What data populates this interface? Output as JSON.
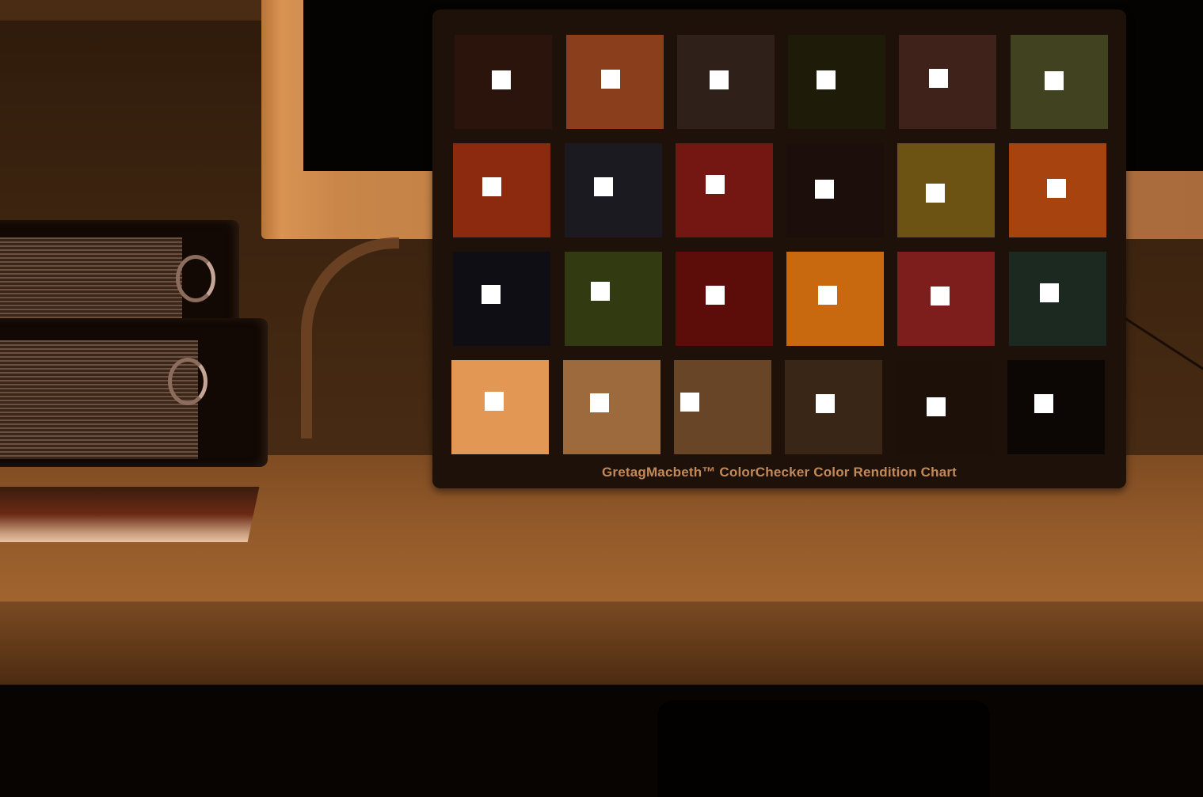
{
  "chart_caption": "GretagMacbeth™ ColorChecker Color Rendition Chart",
  "patch_colors": [
    [
      "#2b140c",
      "#8a3e1b",
      "#2f2119",
      "#1e1b09",
      "#3f2219",
      "#414220"
    ],
    [
      "#8c2a10",
      "#1a1a20",
      "#741712",
      "#1b0e0b",
      "#6c5314",
      "#a6430f"
    ],
    [
      "#0e0e14",
      "#313a10",
      "#5c0d0a",
      "#c9690f",
      "#7d1d1c",
      "#1b2921"
    ],
    [
      "#e29755",
      "#9c6a3c",
      "#694528",
      "#3a2616",
      "#1c1008",
      "#0c0705"
    ]
  ],
  "icons": {
    "probe_marker": "white-square-icon"
  }
}
